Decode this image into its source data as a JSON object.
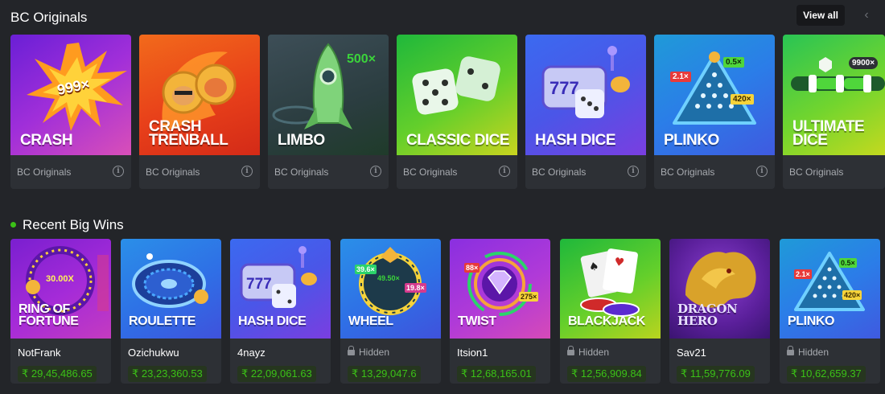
{
  "originals": {
    "title": "BC Originals",
    "view_all": "View all",
    "prev_icon": "chevron-left-icon",
    "cards": [
      {
        "title": "CRASH",
        "badge": "999×",
        "provider": "BC Originals"
      },
      {
        "title": "CRASH TRENBALL",
        "provider": "BC Originals"
      },
      {
        "title": "LIMBO",
        "badge": "500×",
        "provider": "BC Originals"
      },
      {
        "title": "CLASSIC DICE",
        "provider": "BC Originals"
      },
      {
        "title": "HASH DICE",
        "provider": "BC Originals"
      },
      {
        "title": "PLINKO",
        "badges": [
          "0.5×",
          "2.1×",
          "420×"
        ],
        "provider": "BC Originals"
      },
      {
        "title": "ULTIMATE DICE",
        "badge": "9900×",
        "provider": "BC Originals"
      }
    ]
  },
  "recent_wins": {
    "title": "Recent Big Wins",
    "indicator_color": "#3bc117",
    "cards": [
      {
        "title": "RING OF FORTUNE",
        "badge": "30.00X",
        "user": "NotFrank",
        "hidden": false,
        "amount": "₹ 29,45,486.65"
      },
      {
        "title": "ROULETTE",
        "user": "Ozichukwu",
        "hidden": false,
        "amount": "₹ 23,23,360.53"
      },
      {
        "title": "HASH DICE",
        "user": "4nayz",
        "hidden": false,
        "amount": "₹ 22,09,061.63"
      },
      {
        "title": "WHEEL",
        "badges": [
          "39.6×",
          "49.50×",
          "19.8×"
        ],
        "user": "Hidden",
        "hidden": true,
        "amount": "₹ 13,29,047.6"
      },
      {
        "title": "TWIST",
        "badges": [
          "88×",
          "275×"
        ],
        "user": "Itsion1",
        "hidden": false,
        "amount": "₹ 12,68,165.01"
      },
      {
        "title": "BLACKJACK",
        "user": "Hidden",
        "hidden": true,
        "amount": "₹ 12,56,909.84"
      },
      {
        "title": "DRAGON HERO",
        "user": "Sav21",
        "hidden": false,
        "amount": "₹ 11,59,776.09"
      },
      {
        "title": "PLINKO",
        "badges": [
          "2.1×",
          "0.5×",
          "420×"
        ],
        "user": "Hidden",
        "hidden": true,
        "amount": "₹ 10,62,659.37"
      }
    ]
  }
}
